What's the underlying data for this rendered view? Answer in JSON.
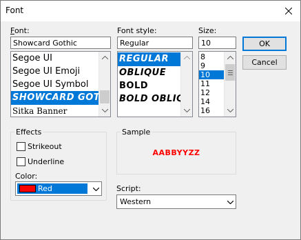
{
  "window": {
    "title": "Font"
  },
  "font": {
    "label": "Font:",
    "value": "Showcard Gothic",
    "items": [
      {
        "text": "Segoe UI",
        "selected": false
      },
      {
        "text": "Segoe UI Emoji",
        "selected": false
      },
      {
        "text": "Segoe UI Symbol",
        "selected": false
      },
      {
        "text": "SHOWCARD GOTH",
        "selected": true
      },
      {
        "text": "Sitka Banner",
        "selected": false
      }
    ]
  },
  "style": {
    "label": "Font style:",
    "value": "Regular",
    "items": [
      {
        "text": "REGULAR",
        "selected": true
      },
      {
        "text": "OBLIQUE",
        "selected": false
      },
      {
        "text": "BOLD",
        "selected": false
      },
      {
        "text": "BOLD OBLIQ",
        "selected": false
      }
    ]
  },
  "size": {
    "label": "Size:",
    "value": "10",
    "items": [
      {
        "text": "8",
        "selected": false
      },
      {
        "text": "9",
        "selected": false
      },
      {
        "text": "10",
        "selected": true
      },
      {
        "text": "11",
        "selected": false
      },
      {
        "text": "12",
        "selected": false
      },
      {
        "text": "14",
        "selected": false
      },
      {
        "text": "16",
        "selected": false
      }
    ]
  },
  "buttons": {
    "ok": "OK",
    "cancel": "Cancel"
  },
  "effects": {
    "title": "Effects",
    "strikeout": "Strikeout",
    "underline": "Underline",
    "color_label": "Color:",
    "color_value": "Red",
    "color_swatch": "#ff0000"
  },
  "sample": {
    "title": "Sample",
    "text": "AaBbYyZz",
    "color": "#ff0000"
  },
  "script": {
    "label": "Script:",
    "value": "Western"
  },
  "colors": {
    "selection": "#0078d7",
    "dialog_bg": "#f0f0f0"
  }
}
